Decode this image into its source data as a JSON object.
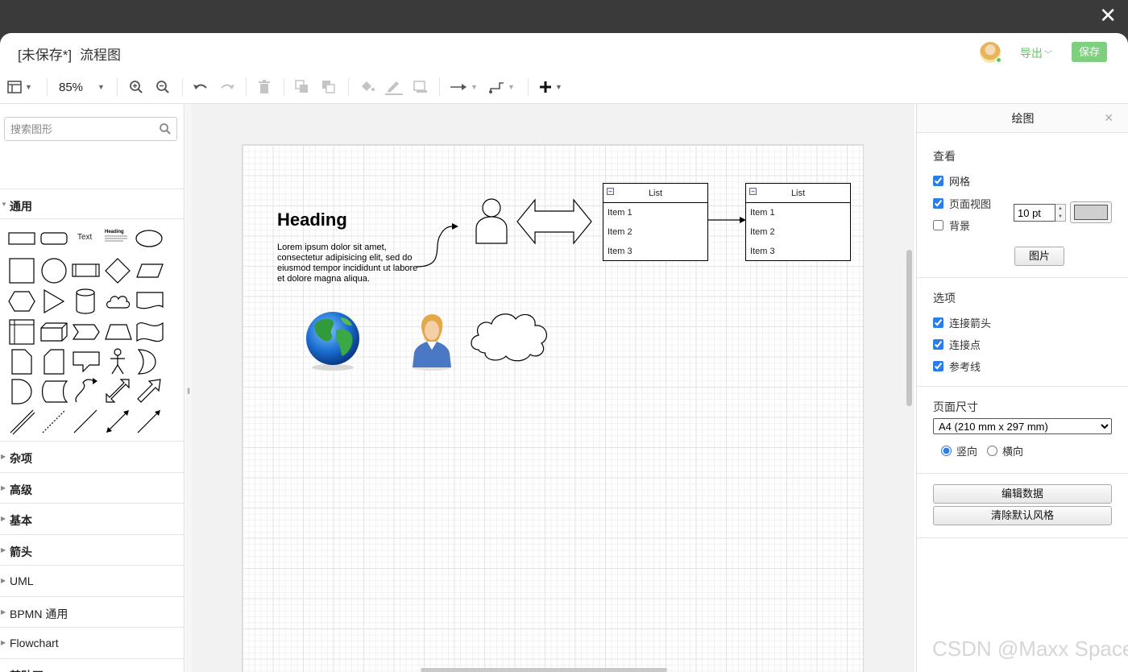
{
  "window": {
    "close_label": "✕"
  },
  "titlebar": {
    "status": "[未保存*]",
    "filename": "流程图",
    "export_label": "导出",
    "save_label": "保存"
  },
  "toolbar": {
    "zoom": "85%"
  },
  "sidebar": {
    "search_placeholder": "搜索图形",
    "general_label": "通用",
    "shape_text": "Text",
    "shape_heading": "Heading",
    "categories": [
      "杂项",
      "高级",
      "基本",
      "箭头",
      "UML",
      "BPMN 通用",
      "Flowchart",
      "剪贴画"
    ]
  },
  "canvas": {
    "heading": "Heading",
    "lorem": "Lorem ipsum dolor sit amet, consectetur adipisicing elit, sed do eiusmod tempor incididunt ut labore et dolore magna aliqua.",
    "list1": {
      "title": "List",
      "items": [
        "Item 1",
        "Item 2",
        "Item 3"
      ]
    },
    "list2": {
      "title": "List",
      "items": [
        "Item 1",
        "Item 2",
        "Item 3"
      ]
    }
  },
  "panel": {
    "title": "绘图",
    "view_title": "查看",
    "grid_label": "网格",
    "grid_checked": true,
    "grid_size": "10 pt",
    "grid_color": "#cfcfcf",
    "pageview_label": "页面视图",
    "pageview_checked": true,
    "background_label": "背景",
    "background_checked": false,
    "image_button": "图片",
    "options_title": "选项",
    "connect_arrows_label": "连接箭头",
    "connect_points_label": "连接点",
    "guides_label": "参考线",
    "page_size_title": "页面尺寸",
    "page_size_value": "A4 (210 mm x 297 mm)",
    "portrait_label": "竖向",
    "landscape_label": "横向",
    "orientation": "portrait",
    "edit_data_button": "编辑数据",
    "clear_style_button": "清除默认风格"
  },
  "watermark": "CSDN @Maxx Space",
  "colors": {
    "accent_green": "#7ed07e",
    "export_green": "#6cc36c",
    "checkbox_blue": "#2b7de9"
  }
}
